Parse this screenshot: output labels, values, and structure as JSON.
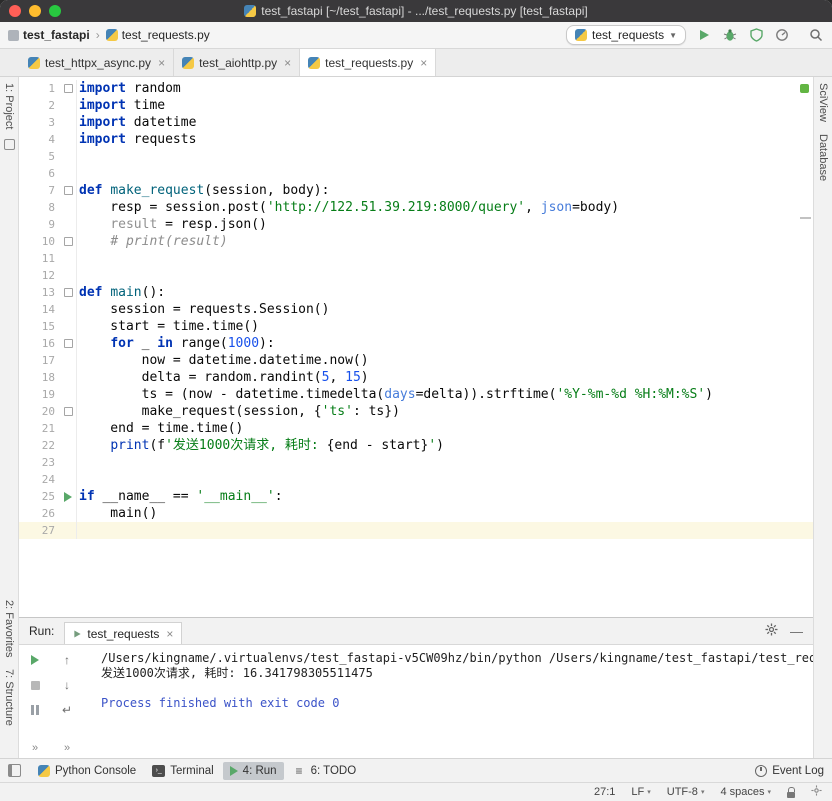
{
  "colors": {
    "keyword": "#0033b3",
    "string": "#067d17",
    "number": "#1750eb",
    "comment": "#8c8c8c",
    "function": "#00627a",
    "parameter": "#467cda",
    "dimmed": "#909090",
    "plain": "#080808",
    "system": "#3b53c8",
    "green": "#59a869",
    "currentline": "#fcf8e3",
    "titlebar": "#3a393b"
  },
  "titlebar": {
    "title": "test_fastapi [~/test_fastapi] - .../test_requests.py [test_fastapi]"
  },
  "navbar": {
    "project": "test_fastapi",
    "file": "test_requests.py",
    "run_config": "test_requests"
  },
  "tabs": [
    {
      "label": "test_httpx_async.py",
      "active": false
    },
    {
      "label": "test_aiohttp.py",
      "active": false
    },
    {
      "label": "test_requests.py",
      "active": true
    }
  ],
  "left_stripe": {
    "top": [
      "1: Project"
    ],
    "bottom": [
      "2: Favorites",
      "7: Structure"
    ]
  },
  "right_stripe": [
    "SciView",
    "Database"
  ],
  "editor": {
    "current_line": 27,
    "run_line": 25,
    "fold_lines": [
      1,
      7,
      10,
      13,
      16,
      20
    ],
    "lines": [
      {
        "num": 1,
        "tokens": [
          [
            "kw",
            "import"
          ],
          [
            "pl",
            " random"
          ]
        ]
      },
      {
        "num": 2,
        "tokens": [
          [
            "kw",
            "import"
          ],
          [
            "pl",
            " time"
          ]
        ]
      },
      {
        "num": 3,
        "tokens": [
          [
            "kw",
            "import"
          ],
          [
            "pl",
            " datetime"
          ]
        ]
      },
      {
        "num": 4,
        "tokens": [
          [
            "kw",
            "import"
          ],
          [
            "pl",
            " requests"
          ]
        ]
      },
      {
        "num": 5,
        "tokens": []
      },
      {
        "num": 6,
        "tokens": []
      },
      {
        "num": 7,
        "tokens": [
          [
            "kw",
            "def"
          ],
          [
            "pl",
            " "
          ],
          [
            "fn",
            "make_request"
          ],
          [
            "pl",
            "(session, body):"
          ]
        ]
      },
      {
        "num": 8,
        "tokens": [
          [
            "pl",
            "    resp = session.post("
          ],
          [
            "str",
            "'http://122.51.39.219:8000/query'"
          ],
          [
            "pl",
            ", "
          ],
          [
            "param",
            "json"
          ],
          [
            "pl",
            "=body)"
          ]
        ]
      },
      {
        "num": 9,
        "tokens": [
          [
            "pl",
            "    "
          ],
          [
            "dim",
            "result"
          ],
          [
            "pl",
            " = resp.json()"
          ]
        ]
      },
      {
        "num": 10,
        "tokens": [
          [
            "pl",
            "    "
          ],
          [
            "cmt",
            "# print(result)"
          ]
        ]
      },
      {
        "num": 11,
        "tokens": []
      },
      {
        "num": 12,
        "tokens": []
      },
      {
        "num": 13,
        "tokens": [
          [
            "kw",
            "def"
          ],
          [
            "pl",
            " "
          ],
          [
            "fn",
            "main"
          ],
          [
            "pl",
            "():"
          ]
        ]
      },
      {
        "num": 14,
        "tokens": [
          [
            "pl",
            "    session = requests.Session()"
          ]
        ]
      },
      {
        "num": 15,
        "tokens": [
          [
            "pl",
            "    start = time.time()"
          ]
        ]
      },
      {
        "num": 16,
        "tokens": [
          [
            "pl",
            "    "
          ],
          [
            "kw",
            "for"
          ],
          [
            "pl",
            " _ "
          ],
          [
            "kw",
            "in"
          ],
          [
            "pl",
            " range("
          ],
          [
            "num",
            "1000"
          ],
          [
            "pl",
            "):"
          ]
        ]
      },
      {
        "num": 17,
        "tokens": [
          [
            "pl",
            "        now = datetime.datetime.now()"
          ]
        ]
      },
      {
        "num": 18,
        "tokens": [
          [
            "pl",
            "        delta = random.randint("
          ],
          [
            "num",
            "5"
          ],
          [
            "pl",
            ", "
          ],
          [
            "num",
            "15"
          ],
          [
            "pl",
            ")"
          ]
        ]
      },
      {
        "num": 19,
        "tokens": [
          [
            "pl",
            "        ts = (now - datetime.timedelta("
          ],
          [
            "param",
            "days"
          ],
          [
            "pl",
            "=delta)).strftime("
          ],
          [
            "str",
            "'%Y-%m-%d %H:%M:%S'"
          ],
          [
            "pl",
            ")"
          ]
        ]
      },
      {
        "num": 20,
        "tokens": [
          [
            "pl",
            "        make_request(session, {"
          ],
          [
            "str",
            "'ts'"
          ],
          [
            "pl",
            ": ts})"
          ]
        ]
      },
      {
        "num": 21,
        "tokens": [
          [
            "pl",
            "    end = time.time()"
          ]
        ]
      },
      {
        "num": 22,
        "tokens": [
          [
            "pl",
            "    "
          ],
          [
            "builtin",
            "print"
          ],
          [
            "pl",
            "(f"
          ],
          [
            "str",
            "'发送1000次请求, 耗时: "
          ],
          [
            "pl",
            "{end - start}"
          ],
          [
            "str",
            "'"
          ],
          [
            "pl",
            ")"
          ]
        ]
      },
      {
        "num": 23,
        "tokens": []
      },
      {
        "num": 24,
        "tokens": []
      },
      {
        "num": 25,
        "tokens": [
          [
            "kw",
            "if"
          ],
          [
            "pl",
            " __name__ == "
          ],
          [
            "str",
            "'__main__'"
          ],
          [
            "pl",
            ":"
          ]
        ]
      },
      {
        "num": 26,
        "tokens": [
          [
            "pl",
            "    main()"
          ]
        ]
      },
      {
        "num": 27,
        "tokens": []
      }
    ]
  },
  "run_panel": {
    "label": "Run:",
    "tab_label": "test_requests",
    "console_lines": [
      {
        "type": "stdout",
        "text": "/Users/kingname/.virtualenvs/test_fastapi-v5CW09hz/bin/python /Users/kingname/test_fastapi/test_request"
      },
      {
        "type": "stdout",
        "text": "发送1000次请求, 耗时: 16.341798305511475"
      },
      {
        "type": "stdout",
        "text": ""
      },
      {
        "type": "system",
        "text": "Process finished with exit code 0"
      }
    ]
  },
  "toolwindow_bar": {
    "items": [
      {
        "label": "Python Console",
        "icon": "python",
        "active": false
      },
      {
        "label": "Terminal",
        "icon": "terminal",
        "active": false
      },
      {
        "label": "4: Run",
        "icon": "run",
        "active": true
      },
      {
        "label": "6: TODO",
        "icon": "todo",
        "active": false
      }
    ],
    "right_item": "Event Log"
  },
  "status_bar": {
    "caret": "27:1",
    "line_separator": "LF",
    "encoding": "UTF-8",
    "indent": "4 spaces"
  }
}
